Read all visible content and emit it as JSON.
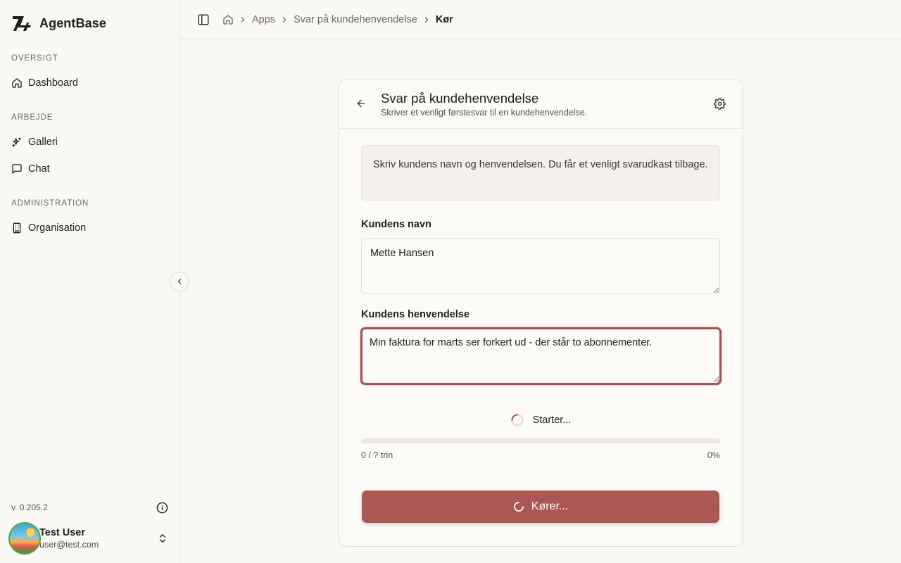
{
  "app": {
    "name": "AgentBase",
    "version": "v. 0.205.2"
  },
  "sidebar": {
    "sections": [
      {
        "label": "OVERSIGT",
        "items": [
          {
            "label": "Dashboard",
            "icon": "home-icon"
          }
        ]
      },
      {
        "label": "ARBEJDE",
        "items": [
          {
            "label": "Galleri",
            "icon": "sparkles-icon"
          },
          {
            "label": "Chat",
            "icon": "message-square-icon"
          }
        ]
      },
      {
        "label": "ADMINISTRATION",
        "items": [
          {
            "label": "Organisation",
            "icon": "building-icon"
          }
        ]
      }
    ],
    "user": {
      "name": "Test User",
      "email": "user@test.com"
    }
  },
  "breadcrumb": {
    "items": [
      "Apps",
      "Svar på kundehenvendelse"
    ],
    "current": "Kør"
  },
  "card": {
    "title": "Svar på kundehenvendelse",
    "subtitle": "Skriver et venligt førstesvar til en kundehenvendelse.",
    "instructions": "Skriv kundens navn og henvendelsen. Du får et venligt svarudkast tilbage.",
    "fields": [
      {
        "label": "Kundens navn",
        "value": "Mette Hansen"
      },
      {
        "label": "Kundens henvendelse",
        "value": "Min faktura for marts ser forkert ud - der står to abonnementer."
      }
    ],
    "status": "Starter...",
    "progress": {
      "steps_label": "0 / ? trin",
      "percent_label": "0%",
      "fraction": 0
    },
    "run_button": "Kører..."
  },
  "colors": {
    "accent": "#ab5754",
    "background": "#fbf9f5",
    "border": "#e5e1da"
  }
}
